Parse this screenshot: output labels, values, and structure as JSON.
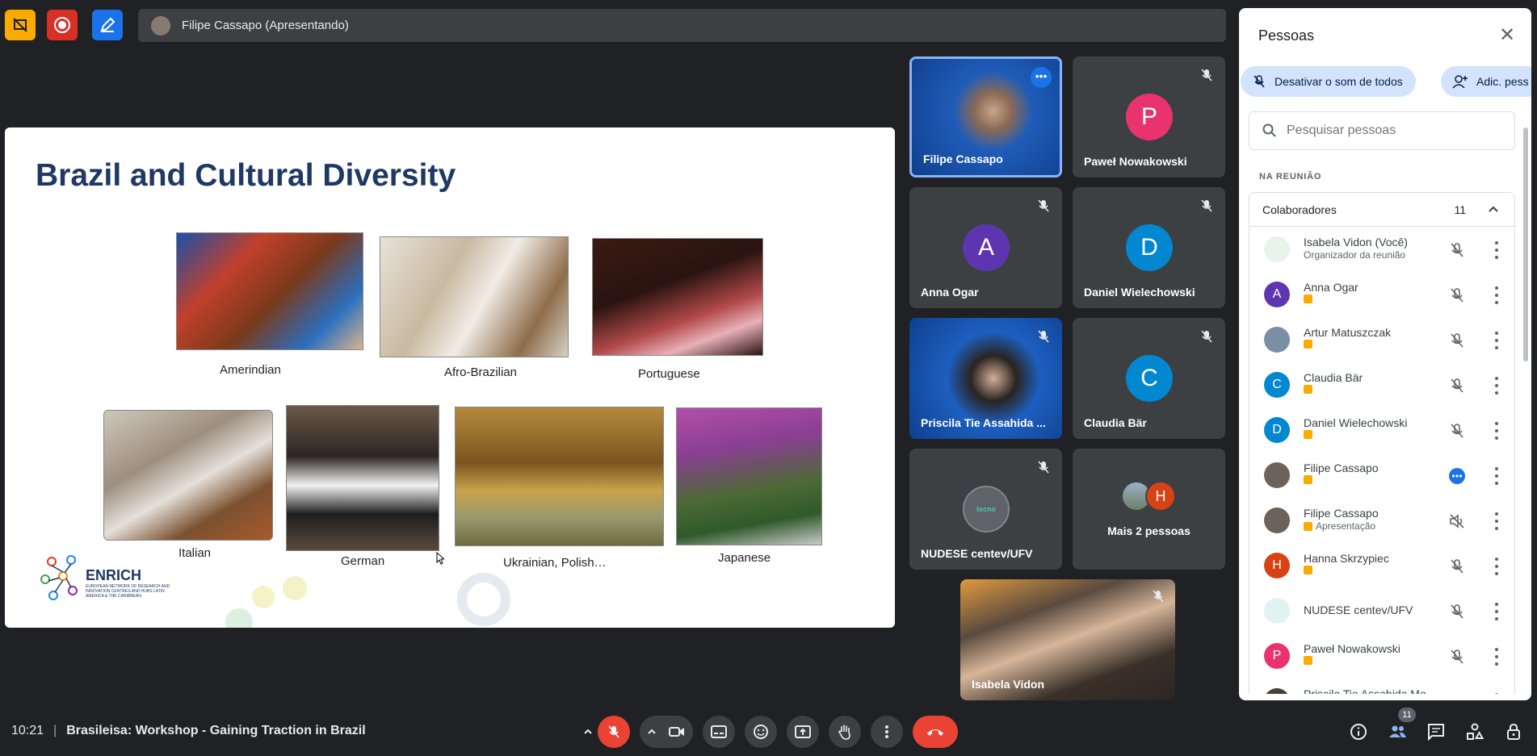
{
  "topbar": {
    "presenter_label": "Filipe Cassapo (Apresentando)"
  },
  "slide": {
    "title": "Brazil and Cultural Diversity",
    "captions": [
      "Amerindian",
      "Afro-Brazilian",
      "Portuguese",
      "Italian",
      "German",
      "Ukrainian, Polish…",
      "Japanese"
    ],
    "logo": {
      "name": "ENRICH",
      "tagline": "EUROPEAN NETWORK OF RESEARCH AND INNOVATION CENTRES AND HUBS LATIN AMERICA & THE CARIBBEAN"
    }
  },
  "tiles": [
    {
      "name": "Filipe Cassapo",
      "kind": "video",
      "active": true
    },
    {
      "name": "Paweł Nowakowski",
      "kind": "avatar",
      "initial": "P",
      "color": "#e8336e"
    },
    {
      "name": "Anna Ogar",
      "kind": "avatar",
      "initial": "A",
      "color": "#5e35b1"
    },
    {
      "name": "Daniel Wielechowski",
      "kind": "avatar",
      "initial": "D",
      "color": "#0288d1"
    },
    {
      "name": "Priscila Tie Assahida ...",
      "kind": "video"
    },
    {
      "name": "Claudia Bär",
      "kind": "avatar",
      "initial": "C",
      "color": "#0288d1"
    },
    {
      "name": "NUDESE centev/UFV",
      "kind": "logo"
    },
    {
      "name": "Mais 2 pessoas",
      "kind": "more",
      "initial": "H"
    },
    {
      "name": "Isabela Vidon",
      "kind": "self-video"
    }
  ],
  "panel": {
    "title": "Pessoas",
    "mute_all_label": "Desativar o som de todos",
    "add_people_label": "Adic. pess",
    "search_placeholder": "Pesquisar pessoas",
    "section_label": "NA REUNIÃO",
    "group_label": "Colaboradores",
    "group_count": "11",
    "participants": [
      {
        "name": "Isabela Vidon (Você)",
        "sub": "Organizador da reunião",
        "initial": "",
        "color": "#e6f4ea",
        "mic": "muted"
      },
      {
        "name": "Anna Ogar",
        "sub": "",
        "initial": "A",
        "color": "#5e35b1",
        "mic": "muted"
      },
      {
        "name": "Artur Matuszczak",
        "sub": "",
        "initial": "",
        "color": "#7a8fa3",
        "mic": "muted"
      },
      {
        "name": "Claudia Bär",
        "sub": "",
        "initial": "C",
        "color": "#0288d1",
        "mic": "muted"
      },
      {
        "name": "Daniel Wielechowski",
        "sub": "",
        "initial": "D",
        "color": "#0288d1",
        "mic": "muted"
      },
      {
        "name": "Filipe Cassapo",
        "sub": "",
        "initial": "",
        "color": "#6d6259",
        "mic": "speaking"
      },
      {
        "name": "Filipe Cassapo",
        "sub": "Apresentação",
        "initial": "",
        "color": "#6d6259",
        "mic": "off"
      },
      {
        "name": "Hanna Skrzypiec",
        "sub": "",
        "initial": "H",
        "color": "#d84315",
        "mic": "muted"
      },
      {
        "name": "NUDESE centev/UFV",
        "sub": "",
        "initial": "",
        "color": "#e0f2f1",
        "mic": "muted"
      },
      {
        "name": "Paweł Nowakowski",
        "sub": "",
        "initial": "P",
        "color": "#e8336e",
        "mic": "muted"
      },
      {
        "name": "Priscila Tie Assahida Mo...",
        "sub": "",
        "initial": "",
        "color": "#4a3f36",
        "mic": "muted"
      }
    ]
  },
  "bottom": {
    "time": "10:21",
    "separator": "|",
    "meeting_name": "Brasileisa: Workshop - Gaining Traction in Brazil",
    "people_count": "11"
  }
}
